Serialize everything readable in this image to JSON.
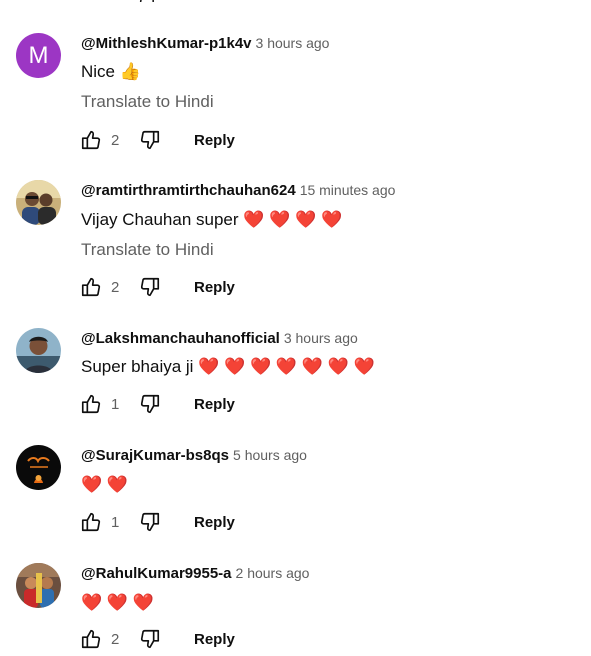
{
  "comments": [
    {
      "author": "@MithleshKumar-p1k4v",
      "time": "3 hours ago",
      "text": "Nice 👍",
      "translate": "Translate to Hindi",
      "likes": "2",
      "reply": "Reply",
      "avatar_letter": "M",
      "avatar_color": "#9c36c4"
    },
    {
      "author": "@ramtirthramtirthchauhan624",
      "time": "15 minutes ago",
      "text": "Vijay Chauhan super ❤️ ❤️ ❤️ ❤️",
      "translate": "Translate to Hindi",
      "likes": "2",
      "reply": "Reply"
    },
    {
      "author": "@Lakshmanchauhanofficial",
      "time": "3 hours ago",
      "text": "Super bhaiya ji ❤️ ❤️ ❤️ ❤️ ❤️ ❤️ ❤️",
      "likes": "1",
      "reply": "Reply"
    },
    {
      "author": "@SurajKumar-bs8qs",
      "time": "5 hours ago",
      "text": "❤️ ❤️",
      "likes": "1",
      "reply": "Reply"
    },
    {
      "author": "@RahulKumar9955-a",
      "time": "2 hours ago",
      "text": "❤️ ❤️ ❤️",
      "likes": "2",
      "reply": "Reply"
    }
  ],
  "icons": {
    "like": "thumb-up-icon",
    "dislike": "thumb-down-icon"
  },
  "colors": {
    "text_primary": "#0f0f0f",
    "text_secondary": "#606060",
    "heart": "#e0243a"
  }
}
